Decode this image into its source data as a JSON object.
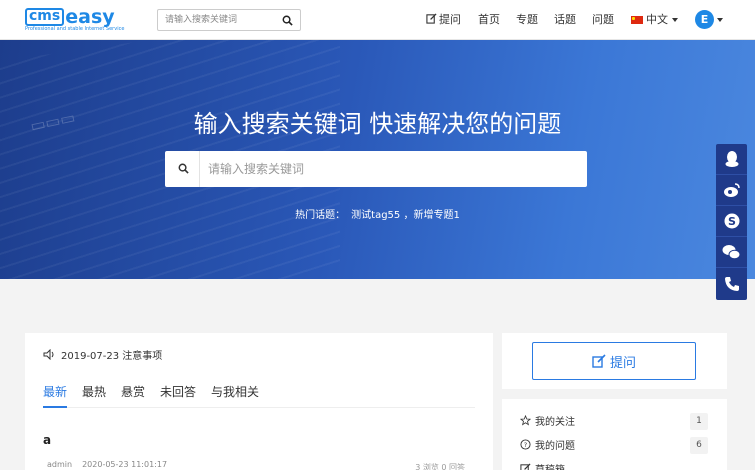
{
  "header": {
    "logo_text": "cmseasy",
    "logo_sub": "Professional and stable Internet Service",
    "search_placeholder": "请输入搜索关键词",
    "nav": {
      "ask": "提问",
      "home": "首页",
      "topics": "专题",
      "tags": "话题",
      "questions": "问题",
      "language": "中文"
    },
    "avatar_letter": "E"
  },
  "banner": {
    "title": "输入搜索关键词 快速解决您的问题",
    "search_placeholder": "请输入搜索关键词",
    "hot_label": "热门话题：",
    "hot_links": "测试tag55 ，新增专题1"
  },
  "float_bar": {
    "icons": [
      "qq-icon",
      "weibo-icon",
      "skype-icon",
      "wechat-icon",
      "phone-icon"
    ]
  },
  "main": {
    "notice": "2019-07-23 注意事项",
    "tabs": [
      "最新",
      "最热",
      "悬赏",
      "未回答",
      "与我相关"
    ],
    "post": {
      "title": "a",
      "author": "admin",
      "date": "2020-05-23 11:01:17",
      "stats": "3 浏览   0 回答"
    }
  },
  "sidebar": {
    "ask_label": "提问",
    "links": [
      {
        "label": "我的关注",
        "count": "1"
      },
      {
        "label": "我的问题",
        "count": "6"
      },
      {
        "label": "草稿箱",
        "count": ""
      }
    ]
  },
  "colors": {
    "accent": "#2a7ae2",
    "float_bg": "#1f3a8a",
    "banner_start": "#1d3d8c",
    "banner_end": "#4b88df"
  }
}
